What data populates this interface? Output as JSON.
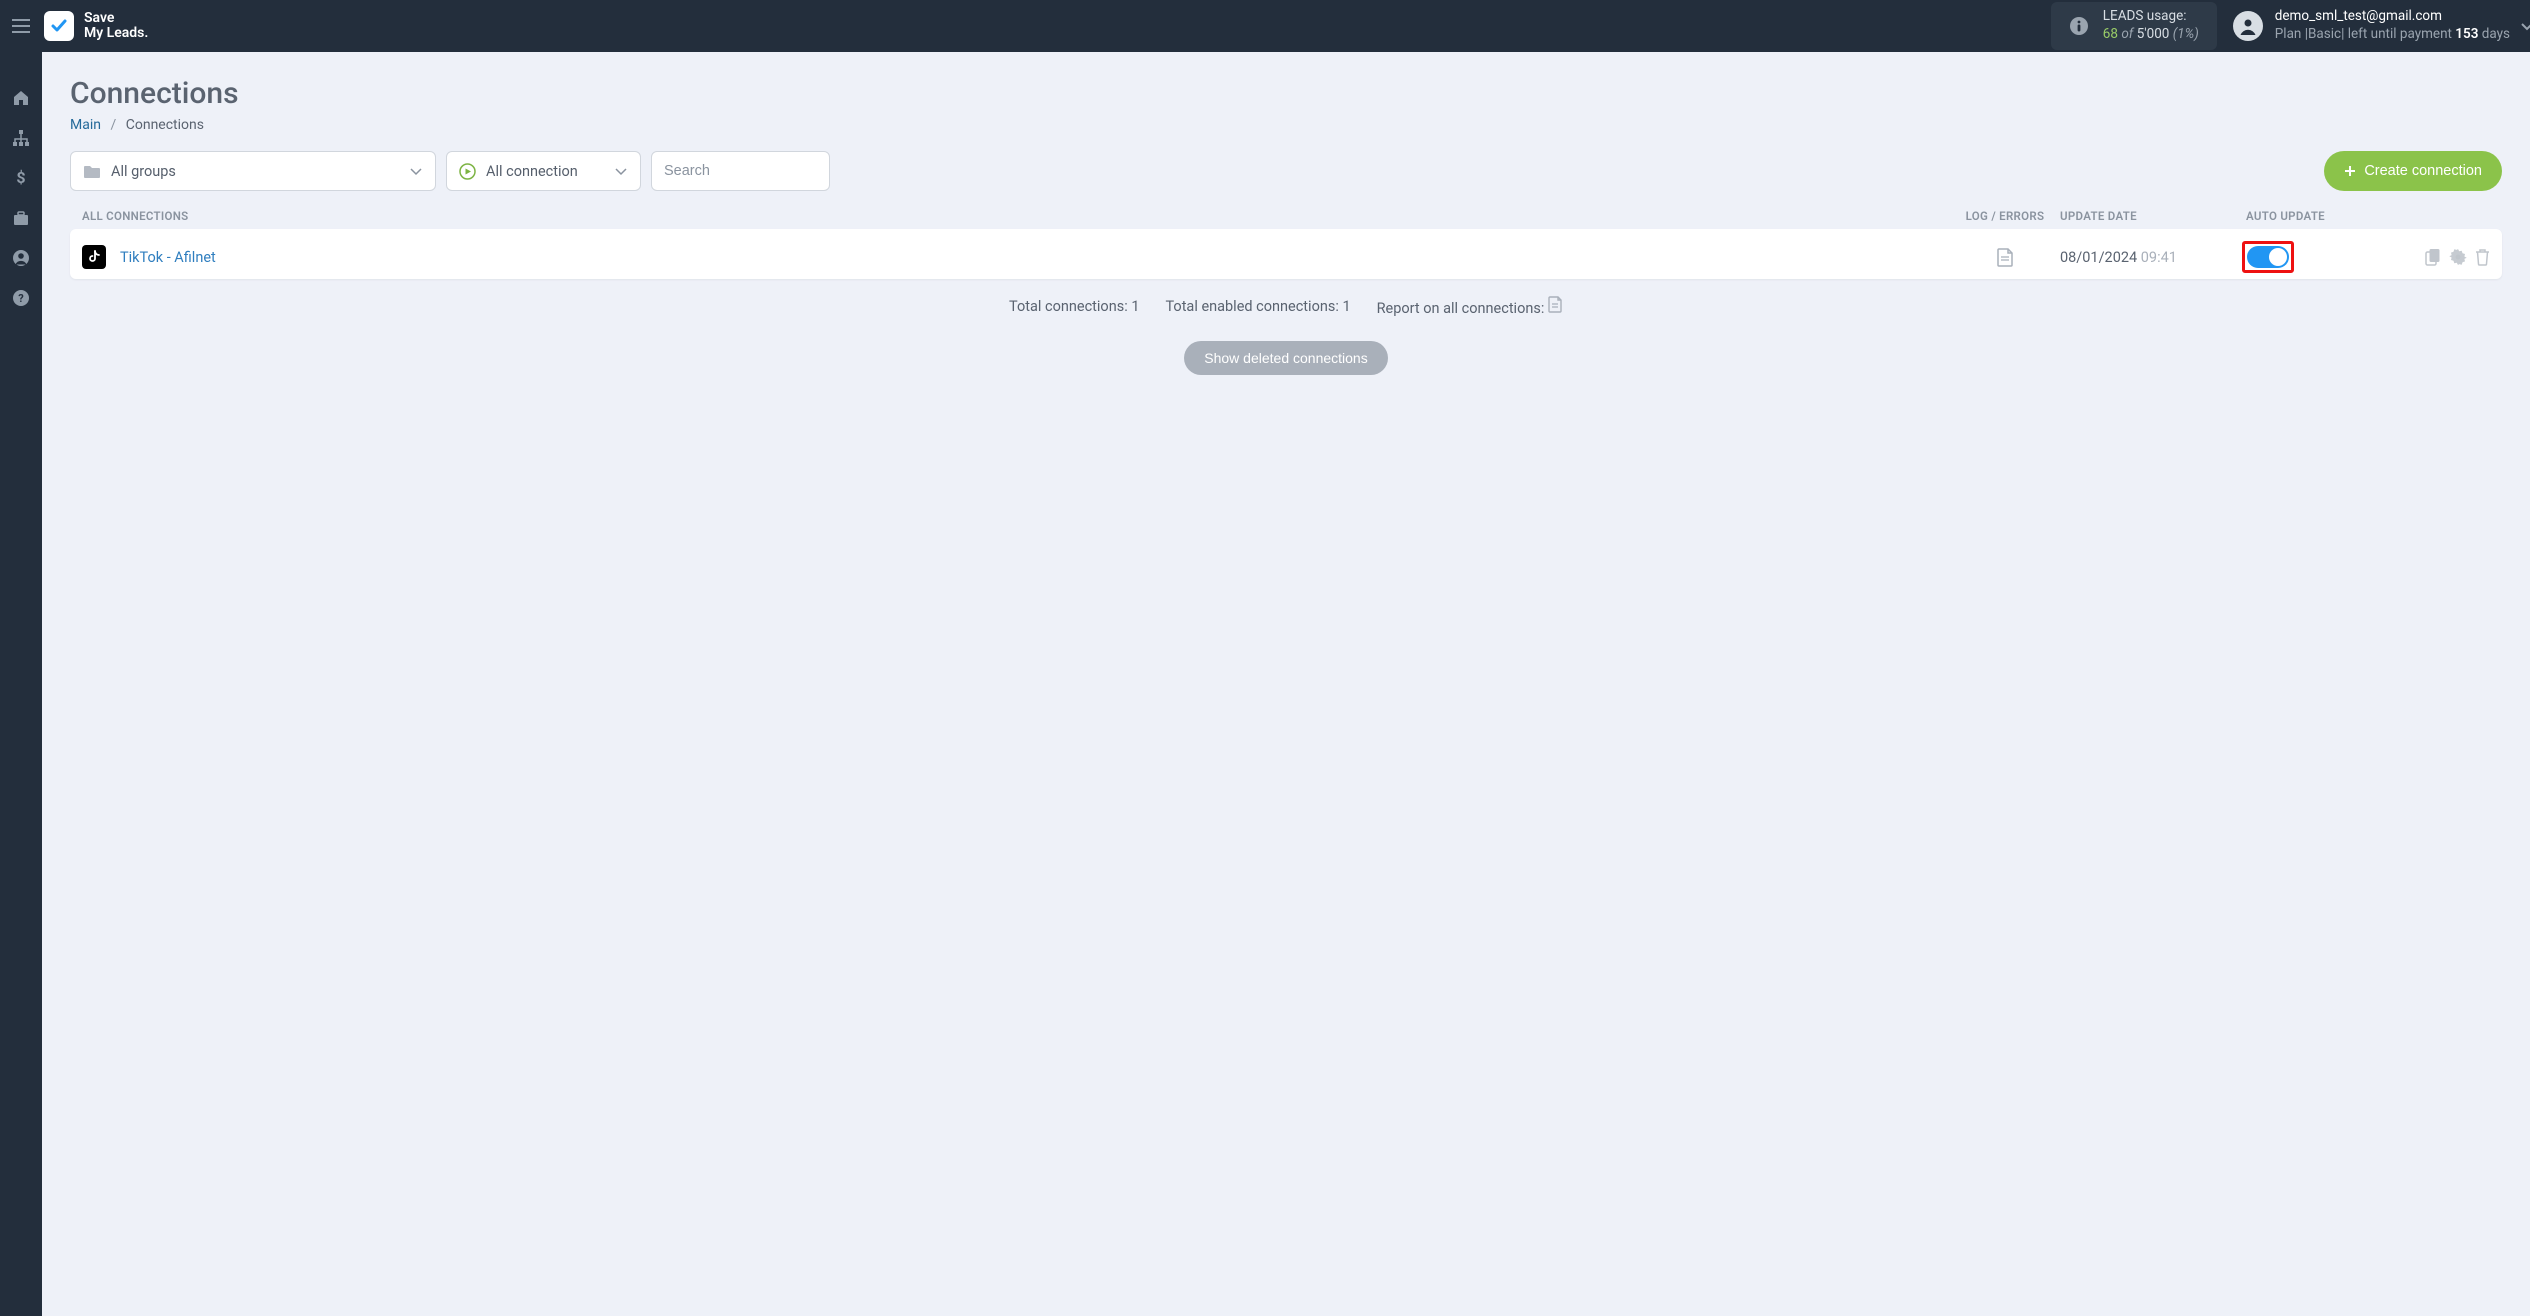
{
  "header": {
    "brand_line1": "Save",
    "brand_line2": "My Leads.",
    "leads_usage": {
      "label": "LEADS usage:",
      "used": "68",
      "of_word": "of",
      "total": "5'000",
      "pct": "(1%)"
    },
    "user": {
      "email": "demo_sml_test@gmail.com",
      "plan_prefix": "Plan |",
      "plan_name": "Basic",
      "plan_middle": "| left until payment ",
      "days": "153",
      "days_suffix": " days"
    }
  },
  "page": {
    "title": "Connections",
    "breadcrumb": {
      "root": "Main",
      "sep": "/",
      "current": "Connections"
    }
  },
  "toolbar": {
    "groups_label": "All groups",
    "status_label": "All connection",
    "search_placeholder": "Search",
    "create_label": "Create connection"
  },
  "table": {
    "headers": {
      "name": "ALL CONNECTIONS",
      "log": "LOG / ERRORS",
      "date": "UPDATE DATE",
      "auto": "AUTO UPDATE"
    },
    "rows": [
      {
        "name": "TikTok - Afilnet",
        "date": "08/01/2024",
        "time": "09:41",
        "auto_update": true
      }
    ]
  },
  "summary": {
    "total_label": "Total connections: ",
    "total_value": "1",
    "enabled_label": "Total enabled connections: ",
    "enabled_value": "1",
    "report_label": "Report on all connections: "
  },
  "buttons": {
    "show_deleted": "Show deleted connections"
  }
}
